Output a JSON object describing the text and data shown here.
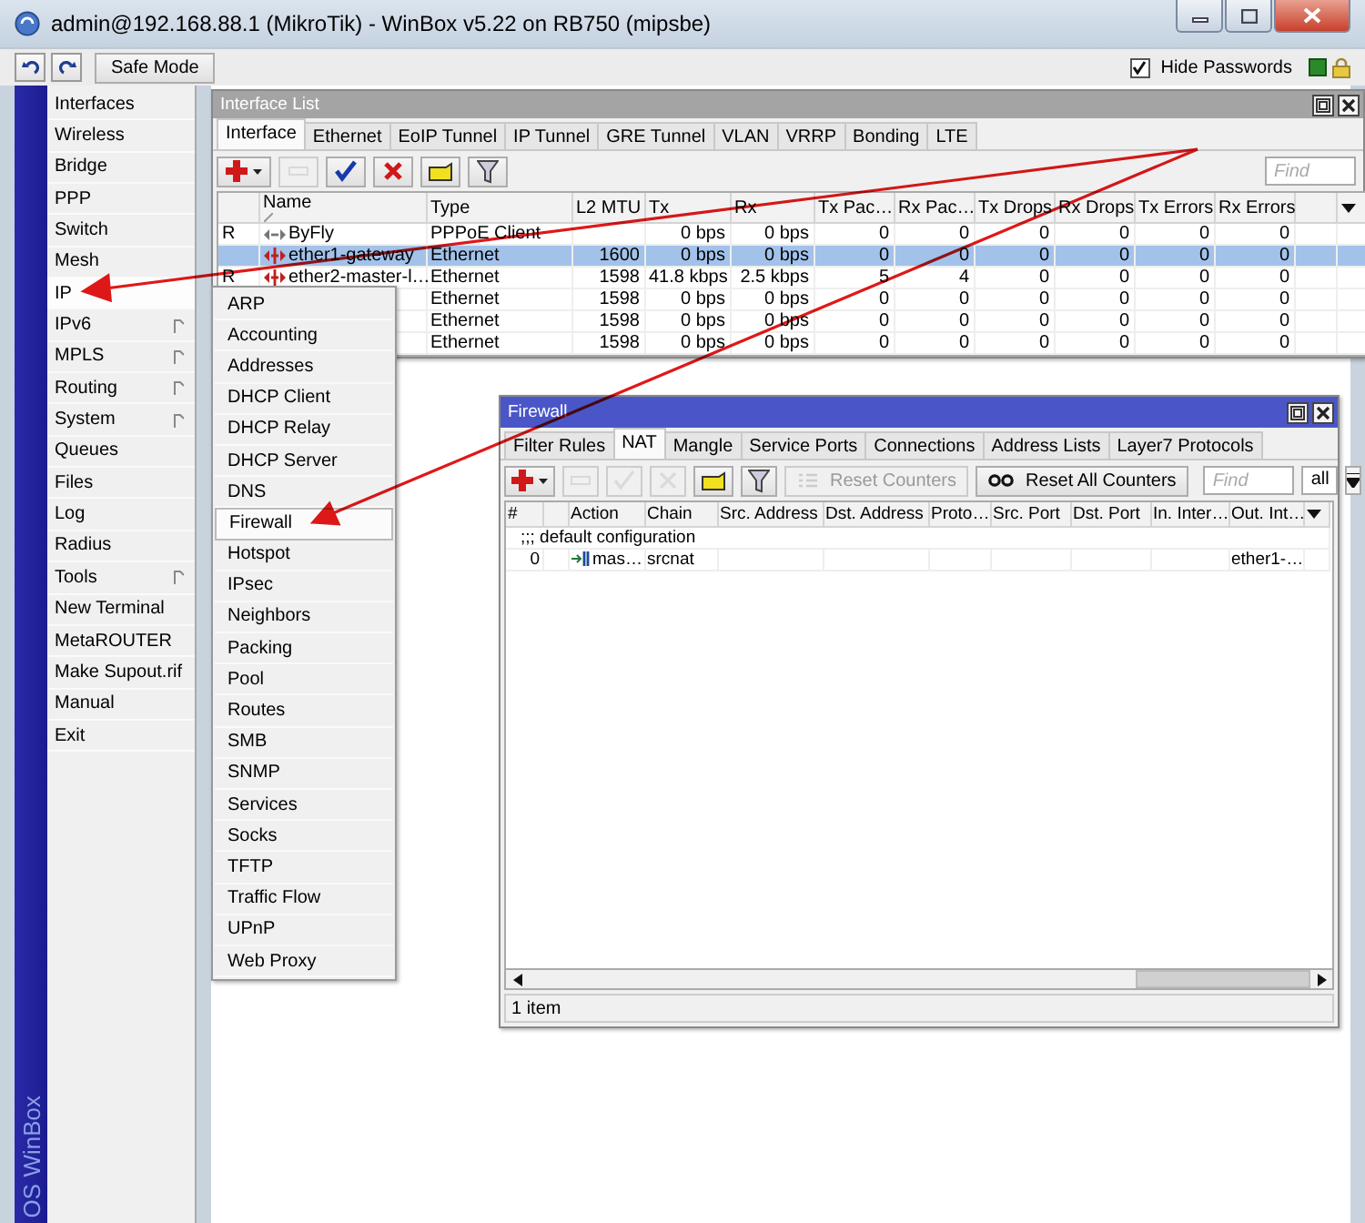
{
  "window": {
    "title": "admin@192.168.88.1 (MikroTik) - WinBox v5.22 on RB750 (mipsbe)"
  },
  "toolbar": {
    "safe_mode": "Safe Mode",
    "hide_passwords": {
      "label": "Hide Passwords",
      "checked": true
    }
  },
  "side_label": "OS WinBox",
  "menu": [
    {
      "label": "Interfaces",
      "kind": "item",
      "selected": false
    },
    {
      "label": "Wireless",
      "kind": "item",
      "selected": false
    },
    {
      "label": "Bridge",
      "kind": "item",
      "selected": false
    },
    {
      "label": "PPP",
      "kind": "item",
      "selected": false
    },
    {
      "label": "Switch",
      "kind": "item",
      "selected": false
    },
    {
      "label": "Mesh",
      "kind": "item",
      "selected": false
    },
    {
      "label": "IP",
      "kind": "item",
      "selected": true
    },
    {
      "label": "IPv6",
      "kind": "submenu",
      "selected": false
    },
    {
      "label": "MPLS",
      "kind": "submenu",
      "selected": false
    },
    {
      "label": "Routing",
      "kind": "submenu",
      "selected": false
    },
    {
      "label": "System",
      "kind": "submenu",
      "selected": false
    },
    {
      "label": "Queues",
      "kind": "item",
      "selected": false
    },
    {
      "label": "Files",
      "kind": "item",
      "selected": false
    },
    {
      "label": "Log",
      "kind": "item",
      "selected": false
    },
    {
      "label": "Radius",
      "kind": "item",
      "selected": false
    },
    {
      "label": "Tools",
      "kind": "submenu",
      "selected": false
    },
    {
      "label": "New Terminal",
      "kind": "item",
      "selected": false
    },
    {
      "label": "MetaROUTER",
      "kind": "item",
      "selected": false
    },
    {
      "label": "Make Supout.rif",
      "kind": "item",
      "selected": false
    },
    {
      "label": "Manual",
      "kind": "item",
      "selected": false
    },
    {
      "label": "Exit",
      "kind": "item",
      "selected": false
    }
  ],
  "ip_submenu": [
    {
      "label": "ARP",
      "selected": false
    },
    {
      "label": "Accounting",
      "selected": false
    },
    {
      "label": "Addresses",
      "selected": false
    },
    {
      "label": "DHCP Client",
      "selected": false
    },
    {
      "label": "DHCP Relay",
      "selected": false
    },
    {
      "label": "DHCP Server",
      "selected": false
    },
    {
      "label": "DNS",
      "selected": false
    },
    {
      "label": "Firewall",
      "selected": true
    },
    {
      "label": "Hotspot",
      "selected": false
    },
    {
      "label": "IPsec",
      "selected": false
    },
    {
      "label": "Neighbors",
      "selected": false
    },
    {
      "label": "Packing",
      "selected": false
    },
    {
      "label": "Pool",
      "selected": false
    },
    {
      "label": "Routes",
      "selected": false
    },
    {
      "label": "SMB",
      "selected": false
    },
    {
      "label": "SNMP",
      "selected": false
    },
    {
      "label": "Services",
      "selected": false
    },
    {
      "label": "Socks",
      "selected": false
    },
    {
      "label": "TFTP",
      "selected": false
    },
    {
      "label": "Traffic Flow",
      "selected": false
    },
    {
      "label": "UPnP",
      "selected": false
    },
    {
      "label": "Web Proxy",
      "selected": false
    }
  ],
  "interface_list": {
    "title": "Interface List",
    "active": false,
    "tabs": [
      {
        "label": "Interface",
        "selected": true
      },
      {
        "label": "Ethernet",
        "selected": false
      },
      {
        "label": "EoIP Tunnel",
        "selected": false
      },
      {
        "label": "IP Tunnel",
        "selected": false
      },
      {
        "label": "GRE Tunnel",
        "selected": false
      },
      {
        "label": "VLAN",
        "selected": false
      },
      {
        "label": "VRRP",
        "selected": false
      },
      {
        "label": "Bonding",
        "selected": false
      },
      {
        "label": "LTE",
        "selected": false
      }
    ],
    "buttons": [
      {
        "kind": "add",
        "disabled": false
      },
      {
        "kind": "remove",
        "disabled": true
      },
      {
        "kind": "enable",
        "disabled": false
      },
      {
        "kind": "disable",
        "disabled": false
      },
      {
        "kind": "comment",
        "disabled": false
      },
      {
        "kind": "filter",
        "disabled": false
      }
    ],
    "find_placeholder": "Find",
    "columns": [
      "Name",
      "Type",
      "L2 MTU",
      "Tx",
      "Rx",
      "Tx Pac…",
      "Rx Pac…",
      "Tx Drops",
      "Rx Drops",
      "Tx Errors",
      "Rx Errors"
    ],
    "rows": [
      {
        "flag": "R",
        "name": "ByFly",
        "kind": "pppoe",
        "selected": false,
        "type": "PPPoE Client",
        "tx": "0 bps",
        "rx": "0 bps",
        "tx_packets": "0",
        "rx_packets": "0",
        "tx_drops": "0",
        "rx_drops": "0",
        "tx_errors": "0",
        "rx_errors": "0"
      },
      {
        "name": "ether1-gateway",
        "kind": "ethernet",
        "selected": true,
        "type": "Ethernet",
        "l2_mtu": "1600",
        "tx": "0 bps",
        "rx": "0 bps",
        "tx_packets": "0",
        "rx_packets": "0",
        "tx_drops": "0",
        "rx_drops": "0",
        "tx_errors": "0",
        "rx_errors": "0"
      },
      {
        "flag": "R",
        "name": "ether2-master-l…",
        "kind": "ethernet",
        "selected": false,
        "type": "Ethernet",
        "l2_mtu": "1598",
        "tx": "41.8 kbps",
        "rx": "2.5 kbps",
        "tx_packets": "5",
        "rx_packets": "4",
        "tx_drops": "0",
        "rx_drops": "0",
        "tx_errors": "0",
        "rx_errors": "0"
      },
      {
        "selected": false,
        "type": "Ethernet",
        "l2_mtu": "1598",
        "tx": "0 bps",
        "rx": "0 bps",
        "tx_packets": "0",
        "rx_packets": "0",
        "tx_drops": "0",
        "rx_drops": "0",
        "tx_errors": "0",
        "rx_errors": "0"
      },
      {
        "selected": false,
        "type": "Ethernet",
        "l2_mtu": "1598",
        "tx": "0 bps",
        "rx": "0 bps",
        "tx_packets": "0",
        "rx_packets": "0",
        "tx_drops": "0",
        "rx_drops": "0",
        "tx_errors": "0",
        "rx_errors": "0"
      },
      {
        "selected": false,
        "type": "Ethernet",
        "l2_mtu": "1598",
        "tx": "0 bps",
        "rx": "0 bps",
        "tx_packets": "0",
        "rx_packets": "0",
        "tx_drops": "0",
        "rx_drops": "0",
        "tx_errors": "0",
        "rx_errors": "0"
      }
    ]
  },
  "firewall": {
    "title": "Firewall",
    "active": true,
    "tabs": [
      {
        "label": "Filter Rules",
        "selected": false
      },
      {
        "label": "NAT",
        "selected": true
      },
      {
        "label": "Mangle",
        "selected": false
      },
      {
        "label": "Service Ports",
        "selected": false
      },
      {
        "label": "Connections",
        "selected": false
      },
      {
        "label": "Address Lists",
        "selected": false
      },
      {
        "label": "Layer7 Protocols",
        "selected": false
      }
    ],
    "buttons": [
      {
        "kind": "add",
        "disabled": false
      },
      {
        "kind": "remove",
        "disabled": true
      },
      {
        "kind": "enable",
        "disabled": true
      },
      {
        "kind": "disable",
        "disabled": true
      },
      {
        "kind": "comment",
        "disabled": false
      },
      {
        "kind": "filter",
        "disabled": false
      },
      {
        "kind": "reset",
        "label": "Reset Counters",
        "disabled": true
      },
      {
        "kind": "reset_all",
        "label": "Reset All Counters",
        "disabled": false
      }
    ],
    "find_placeholder": "Find",
    "chain_filter": "all",
    "columns": [
      "#",
      "Action",
      "Chain",
      "Src. Address",
      "Dst. Address",
      "Proto…",
      "Src. Port",
      "Dst. Port",
      "In. Inter…",
      "Out. Int…"
    ],
    "rows": [
      {
        "kind": "comment",
        "comment": ";;; default configuration"
      },
      {
        "kind": "rule",
        "number": "0",
        "action": "mas…",
        "chain": "srcnat",
        "out_interface": "ether1-…"
      }
    ],
    "status": "1 item"
  }
}
